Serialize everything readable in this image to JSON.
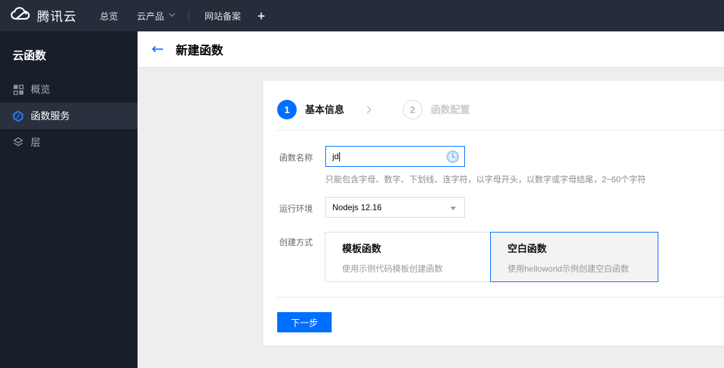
{
  "brand": {
    "name": "腾讯云"
  },
  "topnav": {
    "items": [
      {
        "label": "总览"
      },
      {
        "label": "云产品"
      },
      {
        "label": "网站备案"
      }
    ],
    "plus": "+"
  },
  "sidebar": {
    "title": "云函数",
    "items": [
      {
        "label": "概览",
        "icon": "grid-icon",
        "active": false
      },
      {
        "label": "函数服务",
        "icon": "hexagon-function-icon",
        "active": true
      },
      {
        "label": "层",
        "icon": "layers-icon",
        "active": false
      }
    ]
  },
  "header": {
    "back": "←",
    "title": "新建函数"
  },
  "steps": [
    {
      "num": "1",
      "label": "基本信息",
      "active": true
    },
    {
      "num": "2",
      "label": "函数配置",
      "active": false
    }
  ],
  "form": {
    "name_label": "函数名称",
    "name_value": "jd",
    "name_help": "只能包含字母、数字、下划线、连字符，以字母开头，以数字或字母结尾，2~60个字符",
    "runtime_label": "运行环境",
    "runtime_value": "Nodejs 12.16",
    "method_label": "创建方式",
    "methods": [
      {
        "title": "模板函数",
        "desc": "使用示例代码模板创建函数",
        "selected": false
      },
      {
        "title": "空白函数",
        "desc": "使用helloworld示例创建空白函数",
        "selected": true
      }
    ]
  },
  "actions": {
    "next": "下一步"
  },
  "colors": {
    "accent": "#006eff",
    "nav_bg": "#252d3b",
    "sidebar_bg": "#181e2a",
    "selected_card_bg": "#f3f3f3"
  }
}
